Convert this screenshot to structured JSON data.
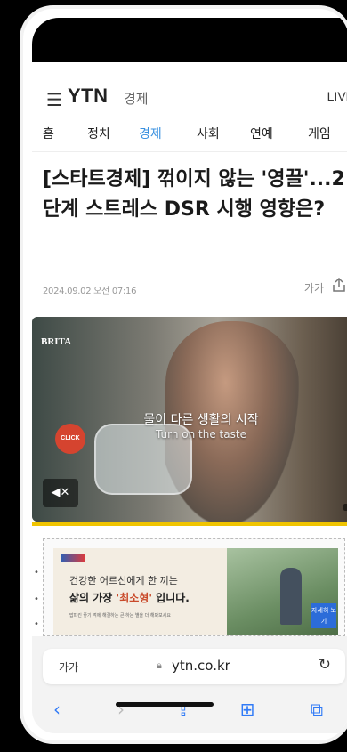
{
  "header": {
    "menu_icon": "hamburger-icon",
    "brand": "YTN",
    "section": "경제",
    "live": "LIVE"
  },
  "nav": {
    "tabs": [
      {
        "label": "홈",
        "active": false
      },
      {
        "label": "정치",
        "active": false
      },
      {
        "label": "경제",
        "active": true
      },
      {
        "label": "사회",
        "active": false
      },
      {
        "label": "연예",
        "active": false
      },
      {
        "label": "게임",
        "active": false
      }
    ]
  },
  "article": {
    "headline": "[스타트경제] 꺾이지 않는 '영끌'...2단계 스트레스 DSR 시행 영향은?",
    "date": "2024.09.02 오전 07:16",
    "font_size_label": "가가"
  },
  "video_ad": {
    "brand": "BRITA",
    "headline": "물이 다른 생활의 시작",
    "tagline": "Turn on the taste",
    "click_label": "CLICK",
    "mute_icon": "speaker-mute-icon"
  },
  "banner_ad": {
    "line1": "건강한 어르신에게 한 끼는",
    "line2_pre": "삶의 가장 ",
    "line2_em": "'최소형'",
    "line2_post": " 입니다.",
    "fine_print": "밥피킨 좋기 먹에 해결하는 큰 하는 별을 더 해봐보세요",
    "button": "자세히 보기"
  },
  "safari": {
    "text_size": "가가",
    "url": "ytn.co.kr",
    "toolbar": [
      {
        "icon": "back-icon",
        "glyph": "‹"
      },
      {
        "icon": "forward-icon",
        "glyph": "›"
      },
      {
        "icon": "share-icon",
        "glyph": "⇪"
      },
      {
        "icon": "bookmarks-icon",
        "glyph": "⊞"
      },
      {
        "icon": "tabs-icon",
        "glyph": "⧉"
      }
    ]
  },
  "colors": {
    "accent": "#3a91e0",
    "safari_blue": "#2f7af7",
    "progress_yellow": "#f0c400"
  }
}
